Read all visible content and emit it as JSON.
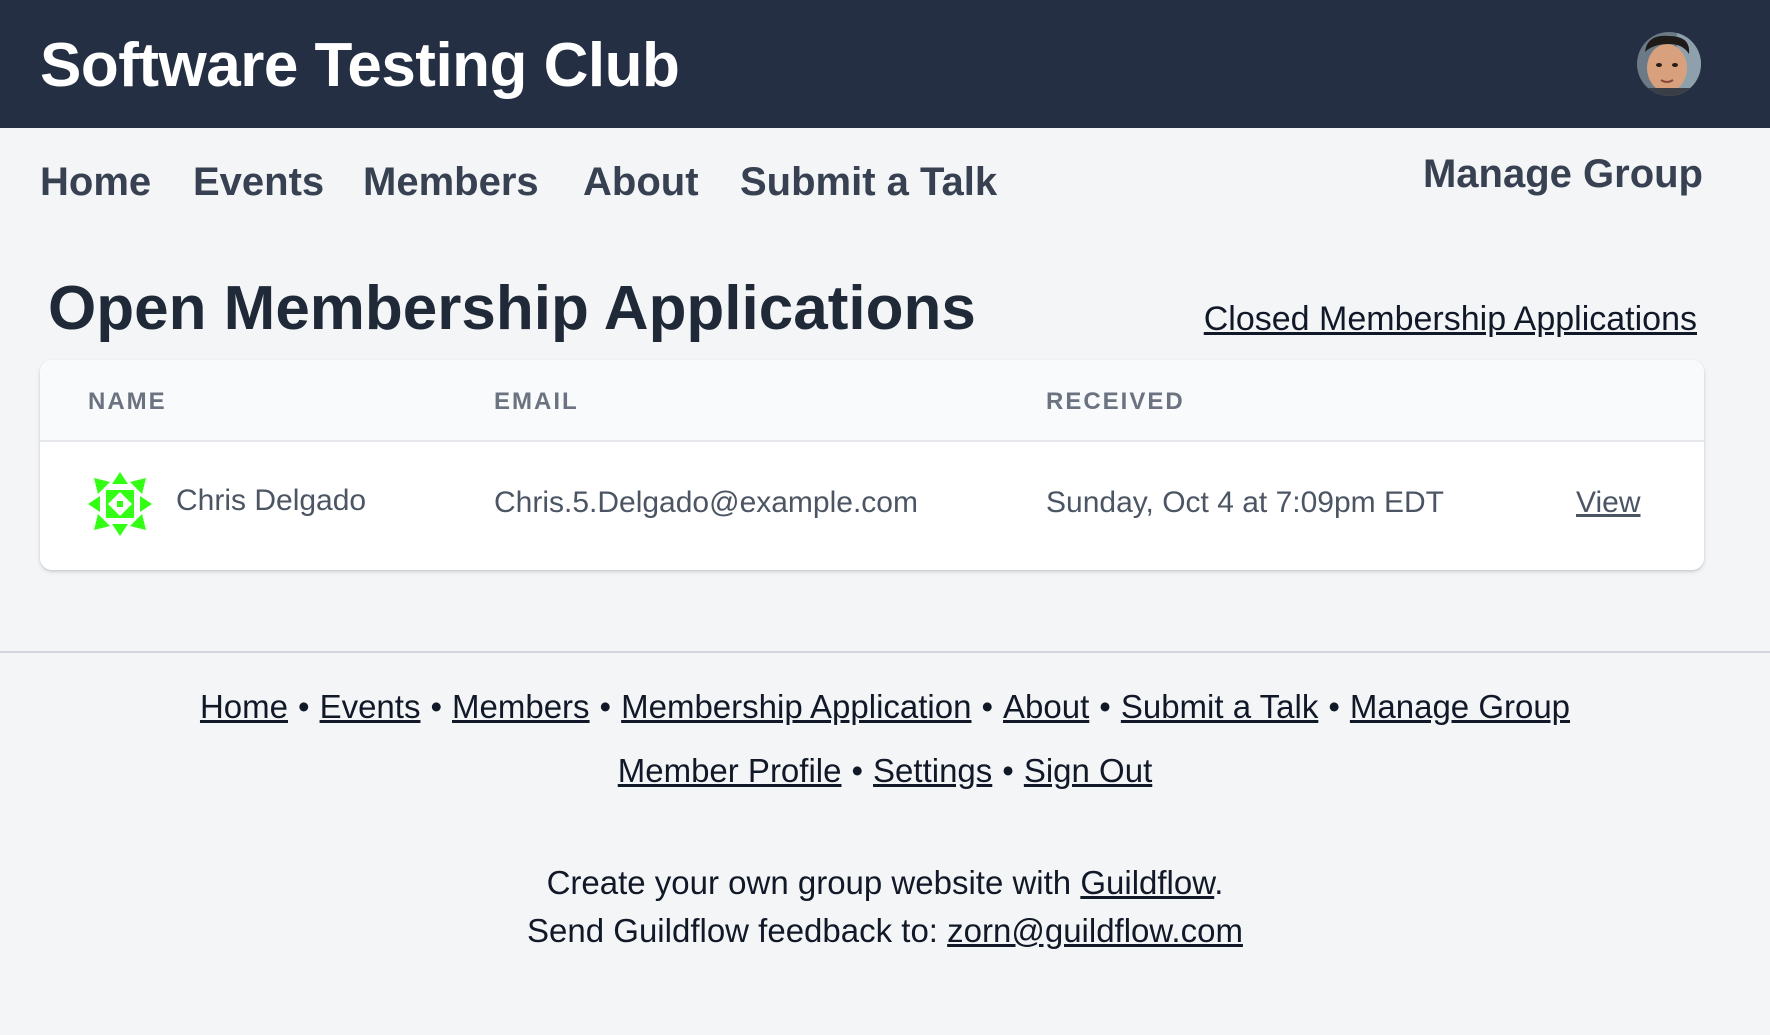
{
  "header": {
    "title": "Software Testing Club",
    "avatar_icon": "user-avatar-photo"
  },
  "nav": {
    "items": [
      {
        "label": "Home"
      },
      {
        "label": "Events"
      },
      {
        "label": "Members"
      },
      {
        "label": "About"
      },
      {
        "label": "Submit a Talk"
      }
    ],
    "manage_label": "Manage Group"
  },
  "main": {
    "title": "Open Membership Applications",
    "closed_link": "Closed Membership Applications",
    "table": {
      "headers": [
        "NAME",
        "EMAIL",
        "RECEIVED"
      ],
      "rows": [
        {
          "name": "Chris Delgado",
          "email": "Chris.5.Delgado@example.com",
          "received": "Sunday, Oct 4 at 7:09pm EDT",
          "action": "View",
          "avatar_icon": "green-identicon",
          "avatar_color": "#33ff14"
        }
      ]
    }
  },
  "footer": {
    "links_row1": [
      "Home",
      "Events",
      "Members",
      "Membership Application",
      "About",
      "Submit a Talk",
      "Manage Group"
    ],
    "links_row2": [
      "Member Profile",
      "Settings",
      "Sign Out"
    ],
    "separator": "•",
    "create_text": "Create your own group website with ",
    "create_link": "Guildflow",
    "create_suffix": ".",
    "feedback_text": "Send Guildflow feedback to: ",
    "feedback_email": "zorn@guildflow.com"
  },
  "colors": {
    "header_bg": "#252f43",
    "page_bg": "#f4f5f7",
    "identicon": "#33ff14"
  }
}
